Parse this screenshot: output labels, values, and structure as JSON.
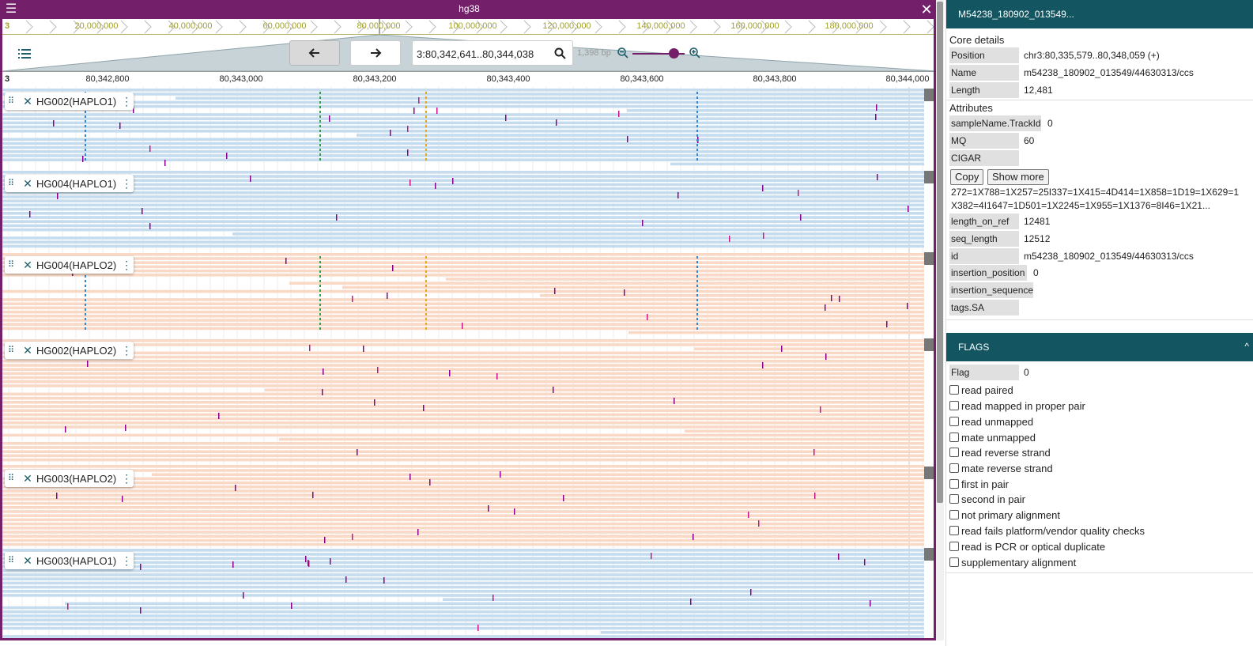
{
  "view": {
    "title": "hg38",
    "assembly_colors": {
      "frame": "#741f6a",
      "panel_header": "#135560"
    }
  },
  "overview": {
    "chrom_label": "3",
    "ticks": [
      "20,000,000",
      "40,000,000",
      "60,000,000",
      "80,000,000",
      "100,000,000",
      "120,000,000",
      "140,000,000",
      "160,000,000",
      "180,000,000"
    ]
  },
  "controls": {
    "location": "3:80,342,641..80,344,038",
    "bp_label": "1,398 bp"
  },
  "ruler": {
    "chrom_label": "3",
    "ticks": [
      "80,342,800",
      "80,343,000",
      "80,343,200",
      "80,343,400",
      "80,343,600",
      "80,343,800",
      "80,344,000"
    ]
  },
  "tracks": [
    {
      "name": "HG002(HAPLO1)",
      "read_color": "#c5dcee"
    },
    {
      "name": "HG004(HAPLO1)",
      "read_color": "#c5dcee"
    },
    {
      "name": "HG004(HAPLO2)",
      "read_color": "#f9d9c6"
    },
    {
      "name": "HG002(HAPLO2)",
      "read_color": "#f9d9c6"
    },
    {
      "name": "HG003(HAPLO2)",
      "read_color": "#f9d9c6"
    },
    {
      "name": "HG003(HAPLO1)",
      "read_color": "#c5dcee"
    }
  ],
  "panel": {
    "header": "M54238_180902_013549...",
    "core_title": "Core details",
    "core": [
      {
        "key": "Position",
        "value": "chr3:80,335,579..80,348,059 (+)"
      },
      {
        "key": "Name",
        "value": "m54238_180902_013549/44630313/ccs"
      },
      {
        "key": "Length",
        "value": "12,481"
      }
    ],
    "attributes_title": "Attributes",
    "attributes_top": [
      {
        "key": "sampleName.TrackId",
        "value": "0"
      },
      {
        "key": "MQ",
        "value": "60"
      },
      {
        "key": "CIGAR",
        "value": ""
      }
    ],
    "copy_label": "Copy",
    "show_more_label": "Show more",
    "cigar_line1": "272=1X788=1X257=25I337=1X415=4D414=1X858=1D19=1X629=1",
    "cigar_line2": "X382=4I1647=1D501=1X2245=1X955=1X1376=8I46=1X21...",
    "attributes_bottom": [
      {
        "key": "length_on_ref",
        "value": "12481"
      },
      {
        "key": "seq_length",
        "value": "12512"
      },
      {
        "key": "id",
        "value": "m54238_180902_013549/44630313/ccs"
      },
      {
        "key": "insertion_position",
        "value": "0"
      },
      {
        "key": "insertion_sequence",
        "value": ""
      },
      {
        "key": "tags.SA",
        "value": ""
      }
    ],
    "flags_header": "FLAGS",
    "flag_key": "Flag",
    "flag_value": "0",
    "flags": [
      "read paired",
      "read mapped in proper pair",
      "read unmapped",
      "mate unmapped",
      "read reverse strand",
      "mate reverse strand",
      "first in pair",
      "second in pair",
      "not primary alignment",
      "read fails platform/vendor quality checks",
      "read is PCR or optical duplicate",
      "supplementary alignment"
    ]
  }
}
